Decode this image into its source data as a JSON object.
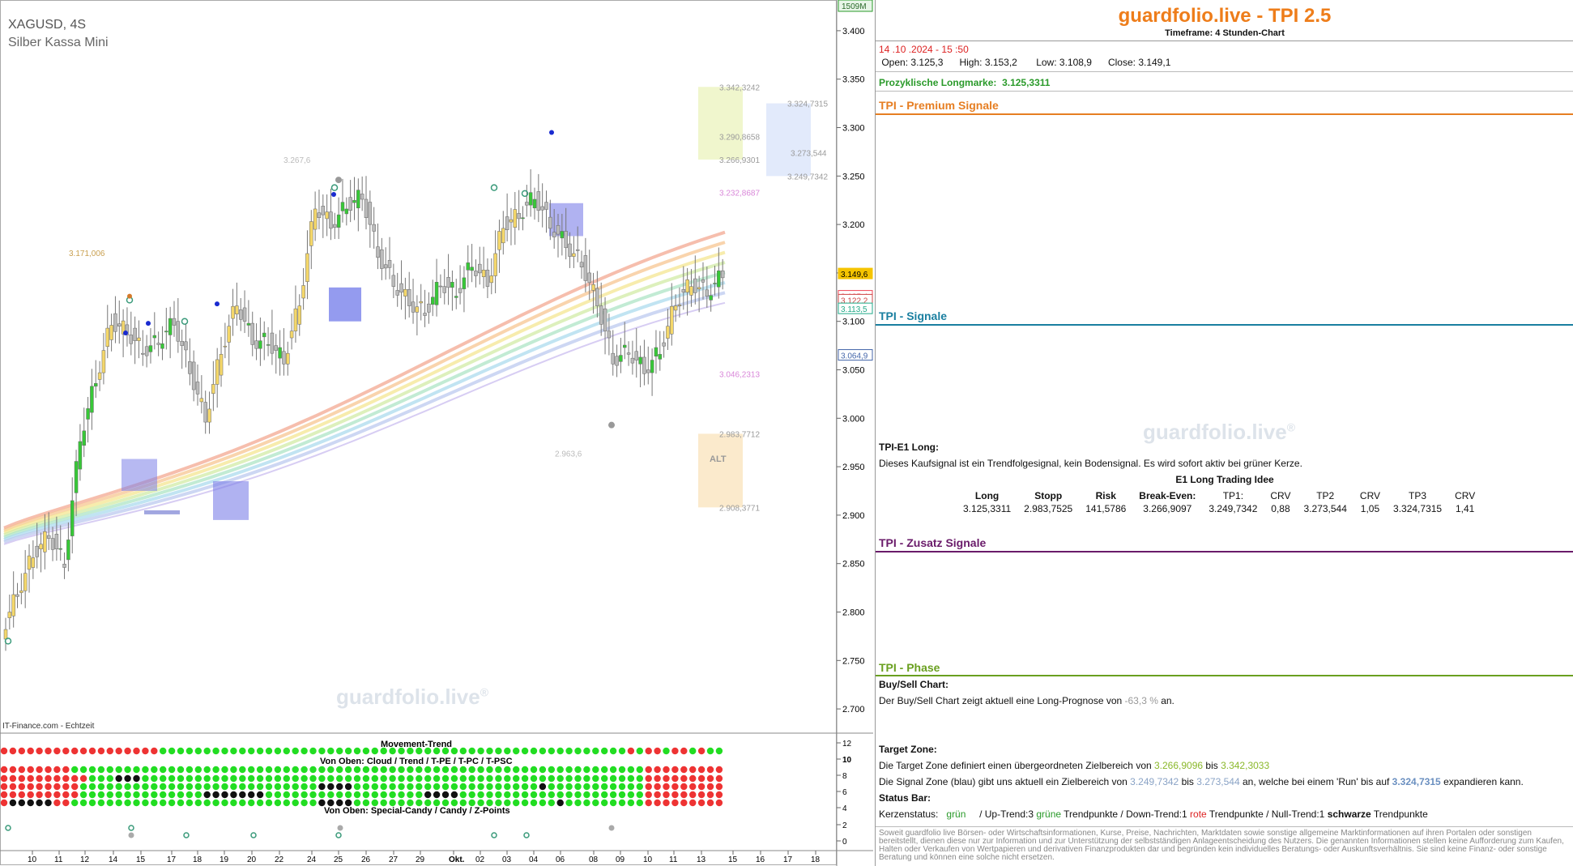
{
  "chart_header": {
    "symbol": "XAGUSD, 4S",
    "name": "Silber Kassa Mini",
    "source": "IT-Finance.com - Echtzeit",
    "watermark": "guardfolio.live",
    "watermark_reg": "®",
    "volume_badge": "1509M"
  },
  "chart_data": {
    "type": "candlestick",
    "y_axis": {
      "min": 2.675,
      "max": 3.425,
      "ticks": [
        "3.400",
        "3.350",
        "3.300",
        "3.250",
        "3.200",
        "3.150",
        "3.100",
        "3.050",
        "3.000",
        "2.950",
        "2.900",
        "2.850",
        "2.800",
        "2.750",
        "2.700"
      ]
    },
    "x_ticks": [
      "10",
      "11",
      "12",
      "14",
      "15",
      "17",
      "18",
      "19",
      "20",
      "22",
      "24",
      "25",
      "26",
      "27",
      "29",
      "Okt.",
      "02",
      "03",
      "04",
      "06",
      "08",
      "09",
      "10",
      "11",
      "13",
      "15",
      "16",
      "17",
      "18"
    ],
    "price_path": [
      2.78,
      2.82,
      2.86,
      2.88,
      2.85,
      2.98,
      3.04,
      3.1,
      3.09,
      3.07,
      3.08,
      3.1,
      3.05,
      3.0,
      3.07,
      3.12,
      3.08,
      3.08,
      3.06,
      3.12,
      3.22,
      3.2,
      3.22,
      3.23,
      3.17,
      3.14,
      3.12,
      3.11,
      3.14,
      3.13,
      3.16,
      3.14,
      3.2,
      3.21,
      3.23,
      3.2,
      3.18,
      3.16,
      3.12,
      3.06,
      3.07,
      3.05,
      3.07,
      3.12,
      3.14,
      3.13,
      3.149
    ],
    "price_labels": [
      {
        "text": "3.149,6",
        "y": 3.149,
        "color": "#f5c400"
      },
      {
        "text": "3.125,4",
        "y": 3.126,
        "color": "#e45"
      },
      {
        "text": "3.122,2",
        "y": 3.122,
        "color": "#c44"
      },
      {
        "text": "3.113,5",
        "y": 3.113,
        "color": "#2a8"
      },
      {
        "text": "3.064,9",
        "y": 3.065,
        "color": "#46a"
      }
    ],
    "zone_labels": [
      {
        "text": "3.342,3242",
        "y": 3.342,
        "color": "#9a9a9a"
      },
      {
        "text": "3.290,8658",
        "y": 3.291,
        "color": "#9a9a9a"
      },
      {
        "text": "3.266,9301",
        "y": 3.267,
        "color": "#9a9a9a"
      },
      {
        "text": "3.232,8687",
        "y": 3.233,
        "color": "#d987d9"
      },
      {
        "text": "3.046,2313",
        "y": 3.046,
        "color": "#d987d9"
      },
      {
        "text": "2.983,7712",
        "y": 2.984,
        "color": "#9a9a9a"
      },
      {
        "text": "2.908,3771",
        "y": 2.908,
        "color": "#9a9a9a"
      },
      {
        "text": "3.324,7315",
        "y": 3.325,
        "color": "#9a9a9a"
      },
      {
        "text": "3.273,544",
        "y": 3.274,
        "color": "#9a9a9a"
      },
      {
        "text": "3.249,7342",
        "y": 3.25,
        "color": "#9a9a9a"
      },
      {
        "text": "3.171,006",
        "y": 3.171,
        "color": "#c9a050"
      },
      {
        "text": "3.267,6",
        "y": 3.267,
        "color": "#bbbbbb"
      },
      {
        "text": "2.963,6",
        "y": 2.964,
        "color": "#bbbbbb"
      }
    ],
    "alt_label": "ALT",
    "indicator": {
      "title": "Movement-Trend",
      "sub1": "Von Oben: Cloud / Trend / T-PE / T-PC / T-PSC",
      "sub2": "Von Oben: Special-Candy / Candy / Z-Points",
      "ticks": [
        "12",
        "10",
        "8",
        "6",
        "4",
        "2",
        "0"
      ]
    }
  },
  "panel": {
    "title": "guardfolio.live - TPI 2.5",
    "subtitle": "Timeframe: 4 Stunden-Chart",
    "date": "14 .10 .2024  - 15 :50",
    "ohlc": {
      "open_label": "Open:",
      "open": "3.125,3",
      "high_label": "High:",
      "high": "3.153,2",
      "low_label": "Low:",
      "low": "3.108,9",
      "close_label": "Close:",
      "close": "3.149,1"
    },
    "longmark_label": "Prozyklische Longmarke:",
    "longmark_value": "3.125,3311",
    "sections": {
      "premium": "TPI - Premium Signale",
      "signale": "TPI - Signale",
      "zusatz": "TPI - Zusatz Signale",
      "phase": "TPI - Phase"
    },
    "colors": {
      "premium": "#e67e22",
      "signale": "#1a7fa0",
      "zusatz": "#6a1b6a",
      "phase": "#6aa020"
    },
    "e1": {
      "heading": "TPI-E1 Long:",
      "text": "Dieses Kaufsignal ist ein Trendfolgesignal, kein Bodensignal. Es wird sofort aktiv bei grüner Kerze.",
      "table_title": "E1 Long Trading Idee",
      "headers": [
        "Long",
        "Stopp",
        "Risk",
        "Break-Even:",
        "TP1:",
        "CRV",
        "TP2",
        "CRV",
        "TP3",
        "CRV"
      ],
      "values": [
        "3.125,3311",
        "2.983,7525",
        "141,5786",
        "3.266,9097",
        "3.249,7342",
        "0,88",
        "3.273,544",
        "1,05",
        "3.324,7315",
        "1,41"
      ]
    },
    "buysell": {
      "heading": "Buy/Sell Chart:",
      "pre": "Der Buy/Sell Chart zeigt aktuell eine Long-Prognose von ",
      "value": "-63,3 %",
      "post": " an."
    },
    "target": {
      "heading": "Target Zone:",
      "line1_pre": "Die Target Zone definiert einen übergeordneten Zielbereich von ",
      "line1_v1": "3.266,9096",
      "line1_mid": " bis ",
      "line1_v2": "3.342,3033",
      "line2_pre": "Die Signal Zone (blau) gibt uns aktuell ein Zielbereich von ",
      "line2_v1": "3.249,7342",
      "line2_mid": " bis  ",
      "line2_v2": "3.273,544",
      "line2_post": "  an, welche bei einem 'Run' bis auf ",
      "line2_v3": "3.324,7315",
      "line2_end": " expandieren kann."
    },
    "status": {
      "heading": "Status Bar:",
      "k_label": "Kerzenstatus:",
      "k_value": "grün",
      "up": "/ Up-Trend:3 ",
      "up_word": "grüne",
      "up_post": " Trendpunkte  / Down-Trend:1 ",
      "down_word": "rote",
      "down_post": " Trendpunkte / Null-Trend:1 ",
      "null_word": "schwarze",
      "null_post": " Trendpunkte"
    },
    "disclaimer": "Soweit guardfolio live Börsen- oder Wirtschaftsinformationen, Kurse, Preise, Nachrichten, Marktdaten sowie sonstige allgemeine Marktinformationen auf ihren Portalen oder sonstigen bereitstellt, dienen diese nur zur Information und zur Unterstützung der selbstständigen Anlageentscheidung des Nutzers. Die genannten Informationen stellen keine Aufforderung zum Kaufen, Halten oder Verkaufen von Wertpapieren und derivativen Finanzprodukten dar und begründen kein individuelles Beratungs- oder Auskunftsverhältnis. Sie sind keine Finanz- oder sonstige Beratung und können eine solche nicht ersetzen.",
    "watermark": "guardfolio.live",
    "watermark_reg": "®"
  }
}
